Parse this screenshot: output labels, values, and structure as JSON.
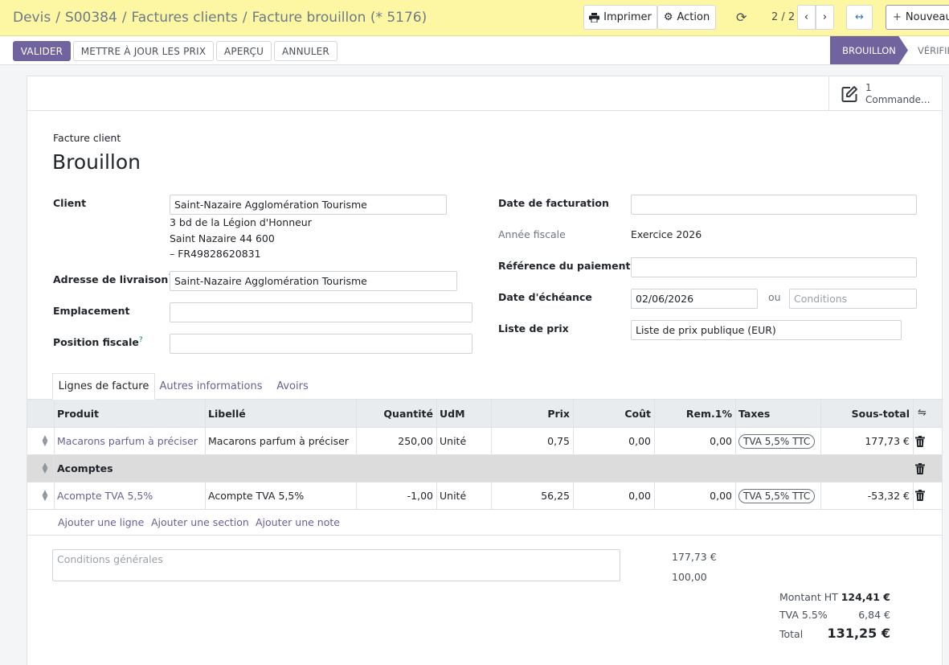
{
  "breadcrumb": [
    "Devis",
    "S00384",
    "Factures clients",
    "Facture brouillon (* 5176)"
  ],
  "topbar": {
    "print_label": "Imprimer",
    "action_label": "Action",
    "pager": "2 / 2",
    "new_label": "Nouveau"
  },
  "actions": {
    "validate": "VALIDER",
    "update_prices": "METTRE À JOUR LES PRIX",
    "preview": "APERÇU",
    "cancel": "ANNULER"
  },
  "statusbar": {
    "active": "BROUILLON",
    "next": "VÉRIFIÉ"
  },
  "smart_button": {
    "count": "1",
    "label": "Commande..."
  },
  "header": {
    "subtitle": "Facture client",
    "title": "Brouillon"
  },
  "left": {
    "client_label": "Client",
    "client_value": "Saint-Nazaire Agglomération Tourisme",
    "address_lines": [
      "3 bd de la Légion d'Honneur",
      "Saint Nazaire 44 600",
      "– FR49828620831"
    ],
    "delivery_label": "Adresse de livraison",
    "delivery_value": "Saint-Nazaire Agglomération Tourisme",
    "location_label": "Emplacement",
    "fiscal_position_label": "Position fiscale",
    "help_mark": "?"
  },
  "right": {
    "invoice_date_label": "Date de facturation",
    "fiscal_year_label": "Année fiscale",
    "fiscal_year_value": "Exercice 2026",
    "payment_ref_label": "Référence du paiement",
    "due_date_label": "Date d'échéance",
    "due_date_value": "02/06/2026",
    "or_label": "ou",
    "conditions_placeholder": "Conditions",
    "pricelist_label": "Liste de prix",
    "pricelist_value": "Liste de prix publique (EUR)"
  },
  "tabs": [
    "Lignes de facture",
    "Autres informations",
    "Avoirs"
  ],
  "table": {
    "headers": [
      "Produit",
      "Libellé",
      "Quantité",
      "UdM",
      "Prix",
      "Coût",
      "Rem.1%",
      "Taxes",
      "Sous-total"
    ],
    "rows": [
      {
        "product": "Macarons parfum à préciser",
        "label": "Macarons parfum à préciser",
        "qty": "250,00",
        "uom": "Unité",
        "price": "0,75",
        "cost": "0,00",
        "disc": "0,00",
        "tax": "TVA 5,5% TTC",
        "subtotal": "177,73 €"
      },
      {
        "section": "Acomptes"
      },
      {
        "product": "Acompte TVA 5,5%",
        "label": "Acompte TVA 5,5%",
        "qty": "-1,00",
        "uom": "Unité",
        "price": "56,25",
        "cost": "0,00",
        "disc": "0,00",
        "tax": "TVA 5,5% TTC",
        "subtotal": "-53,32 €"
      }
    ],
    "add_line": "Ajouter une ligne",
    "add_section": "Ajouter une section",
    "add_note": "Ajouter une note"
  },
  "footer": {
    "terms_placeholder": "Conditions générales",
    "extra_1": "177,73 €",
    "extra_2": "100,00",
    "untaxed_label": "Montant HT",
    "untaxed_value": "124,41 €",
    "vat_label": "TVA 5.5%",
    "vat_value": "6,84 €",
    "total_label": "Total",
    "total_value": "131,25 €"
  },
  "colors": {
    "accent": "#71639e",
    "topbar": "#fdf6a3",
    "link": "#6c5e93"
  }
}
